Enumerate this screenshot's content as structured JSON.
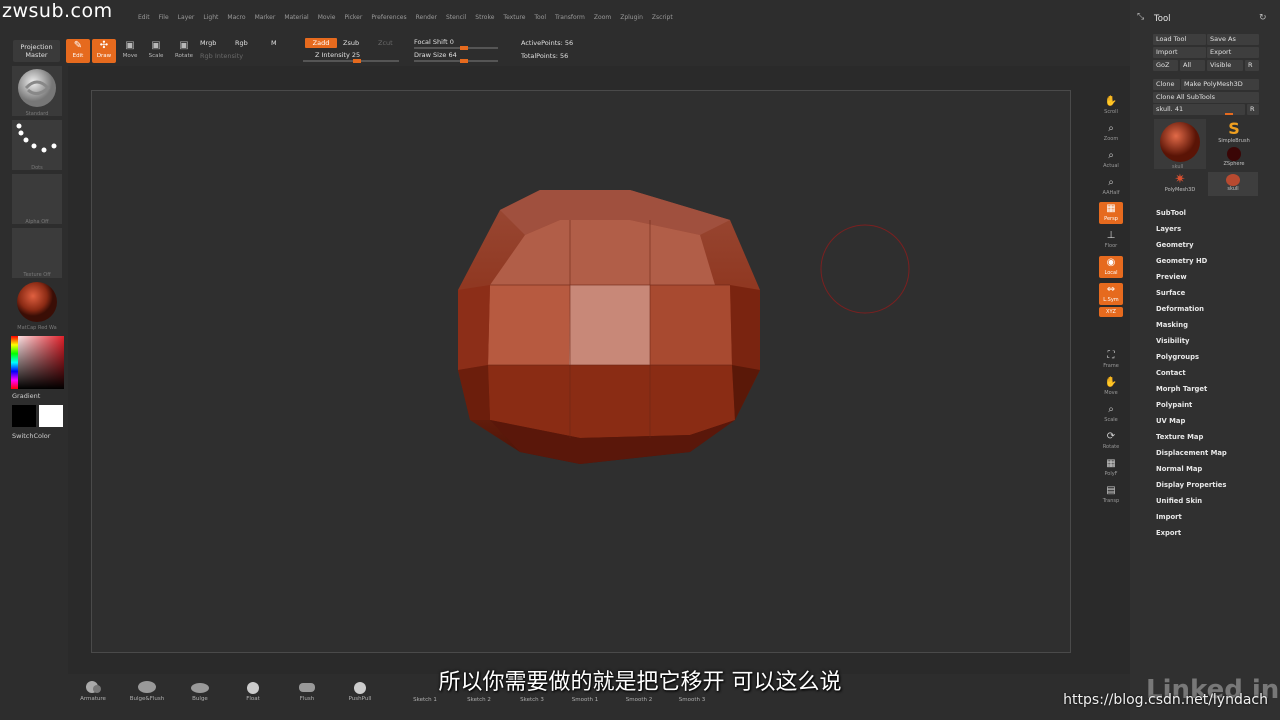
{
  "watermark": {
    "top": "zwsub.com",
    "url": "https://blog.csdn.net/lyndach",
    "brand": "Linked in"
  },
  "menu": [
    "Edit",
    "File",
    "Layer",
    "Light",
    "Macro",
    "Marker",
    "Material",
    "Movie",
    "Picker",
    "Preferences",
    "Render",
    "Stencil",
    "Stroke",
    "Texture",
    "Tool",
    "Transform",
    "Zoom",
    "Zplugin",
    "Zscript"
  ],
  "shelf": {
    "projection_master": "Projection\nMaster",
    "edit": "Edit",
    "draw": "Draw",
    "move": "Move",
    "scale": "Scale",
    "rotate": "Rotate",
    "mrgb": "Mrgb",
    "rgb": "Rgb",
    "m": "M",
    "rgb_intensity": "Rgb  Intensity",
    "zadd": "Zadd",
    "zsub": "Zsub",
    "zcut": "Zcut",
    "z_intensity": "Z Intensity 25",
    "focal_shift": "Focal Shift 0",
    "draw_size": "Draw Size 64",
    "active_points": "ActivePoints: 56",
    "total_points": "TotalPoints: 56",
    "colors": {
      "accent": "#e66a1e"
    }
  },
  "left_tray": {
    "brush": "Standard",
    "stroke": "Dots",
    "alpha": "Alpha  Off",
    "texture": "Texture  Off",
    "material": "MatCap  Red  Wa",
    "gradient": "Gradient",
    "switch_color": "SwitchColor"
  },
  "right_strip": [
    "Scroll",
    "Zoom",
    "Actual",
    "AAHalf",
    "Persp",
    "Floor",
    "Local",
    "L.Sym",
    "XYZ",
    "Frame",
    "Move",
    "Scale",
    "Rotate",
    "PolyF",
    "Transp"
  ],
  "tool_panel": {
    "title": "Tool",
    "load_tool": "Load Tool",
    "save_as": "Save As",
    "import": "Import",
    "export": "Export",
    "goz": "GoZ",
    "all": "All",
    "visible": "Visible",
    "r": "R",
    "clone": "Clone",
    "make_polymesh": "Make PolyMesh3D",
    "clone_all": "Clone  All SubTools",
    "tool_slider": "skull. 41",
    "thumbs": [
      "SimpleBrush",
      "ZSphere",
      "PolyMesh3D",
      "skull"
    ],
    "current": "skull",
    "sections": [
      "SubTool",
      "Layers",
      "Geometry",
      "Geometry HD",
      "Preview",
      "Surface",
      "Deformation",
      "Masking",
      "Visibility",
      "Polygroups",
      "Contact",
      "Morph Target",
      "Polypaint",
      "UV Map",
      "Texture Map",
      "Displacement Map",
      "Normal Map",
      "Display Properties",
      "Unified Skin",
      "Import",
      "Export"
    ]
  },
  "bottom_brushes": [
    "Armature",
    "Bulge&Flush",
    "Bulge",
    "Float",
    "Flush",
    "PushPull",
    "Sketch 1",
    "Sketch 2",
    "Sketch 3",
    "Smooth 1",
    "Smooth 2",
    "Smooth 3"
  ],
  "subtitle": "所以你需要做的就是把它移开  可以这么说"
}
